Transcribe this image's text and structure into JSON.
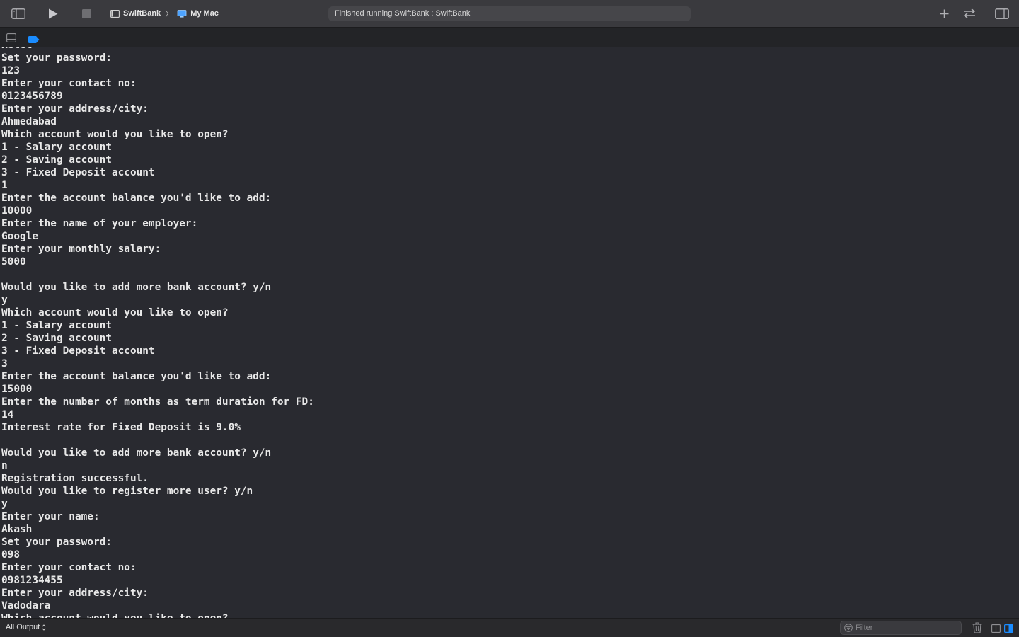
{
  "toolbar": {
    "scheme_target": "SwiftBank",
    "scheme_separator": "〉",
    "scheme_destination": "My Mac",
    "activity_status": "Finished running SwiftBank : SwiftBank",
    "icons": [
      "sidebar-toggle-icon",
      "play-icon",
      "stop-icon",
      "app-icon",
      "mac-icon",
      "plus-icon",
      "swap-arrows-icon",
      "inspector-toggle-icon"
    ]
  },
  "debugbar": {
    "icons": [
      "hide-debug-area-icon",
      "breakpoint-icon"
    ],
    "accent_color": "#1a8cff"
  },
  "console": {
    "lines": [
      "Ketel",
      "Set your password:",
      "123",
      "Enter your contact no:",
      "0123456789",
      "Enter your address/city:",
      "Ahmedabad",
      "Which account would you like to open?",
      "1 - Salary account",
      "2 - Saving account",
      "3 - Fixed Deposit account",
      "1",
      "Enter the account balance you'd like to add:",
      "10000",
      "Enter the name of your employer:",
      "Google",
      "Enter your monthly salary:",
      "5000",
      "",
      "Would you like to add more bank account? y/n",
      "y",
      "Which account would you like to open?",
      "1 - Salary account",
      "2 - Saving account",
      "3 - Fixed Deposit account",
      "3",
      "Enter the account balance you'd like to add:",
      "15000",
      "Enter the number of months as term duration for FD:",
      "14",
      "Interest rate for Fixed Deposit is 9.0%",
      "",
      "Would you like to add more bank account? y/n",
      "n",
      "Registration successful.",
      "Would you like to register more user? y/n",
      "y",
      "Enter your name:",
      "Akash",
      "Set your password:",
      "098",
      "Enter your contact no:",
      "0981234455",
      "Enter your address/city:",
      "Vadodara",
      "Which account would you like to open?"
    ]
  },
  "filterbar": {
    "output_selector": "All Output",
    "filter_placeholder": "Filter",
    "filter_value": "",
    "icons": [
      "chevron-updown-icon",
      "filter-icon",
      "trash-icon",
      "split-left-icon",
      "split-right-icon"
    ],
    "accent_color": "#1a8cff"
  }
}
